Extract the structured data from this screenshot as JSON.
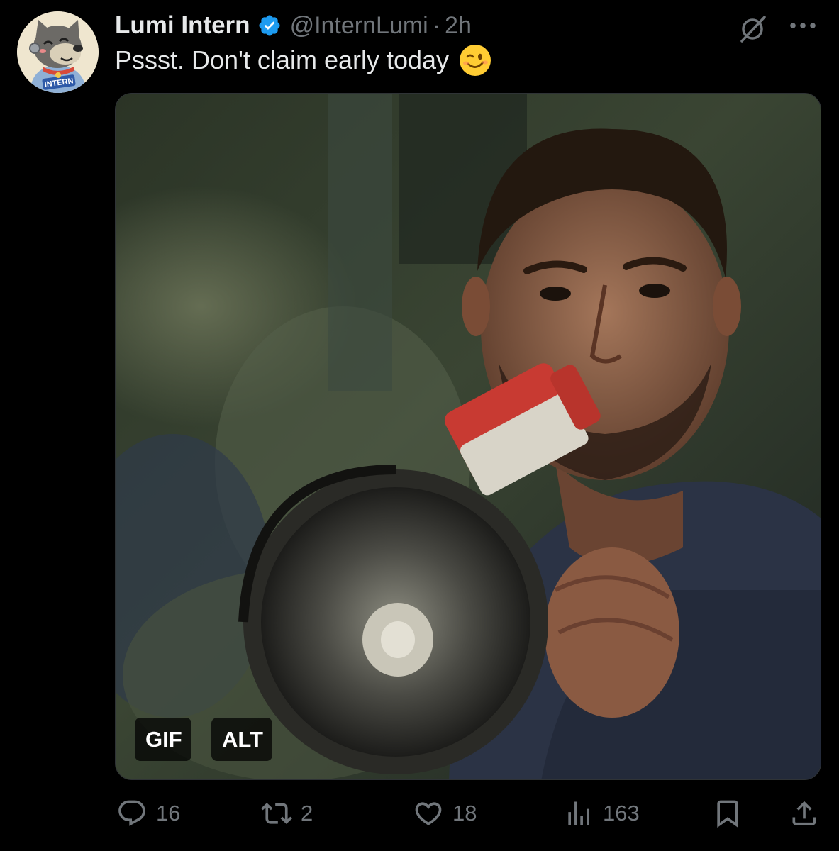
{
  "author": {
    "display_name": "Lumi Intern",
    "handle": "@InternLumi",
    "separator": "·",
    "time": "2h",
    "avatar_badge_text": "INTERN",
    "verified_color": "#1d9bf0"
  },
  "tweet": {
    "text": "Pssst. Don't claim early today",
    "emoji": "winking-face"
  },
  "media": {
    "type": "gif",
    "badge_gif": "GIF",
    "badge_alt": "ALT"
  },
  "actions": {
    "replies": "16",
    "reposts": "2",
    "likes": "18",
    "views": "163"
  },
  "icons": {
    "grok": "grok-slash-icon",
    "more": "more-dots-icon",
    "reply": "reply-bubble-icon",
    "repost": "repost-icon",
    "like": "heart-icon",
    "views": "views-bars-icon",
    "bookmark": "bookmark-icon",
    "share": "share-icon"
  },
  "colors": {
    "background": "#000000",
    "text_primary": "#e7e9ea",
    "text_secondary": "#71767b"
  }
}
